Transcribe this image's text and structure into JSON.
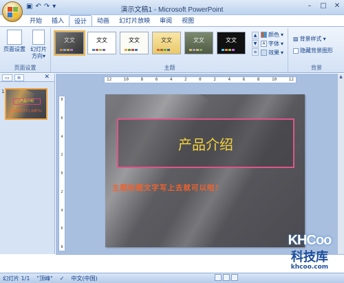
{
  "window": {
    "title": "演示文稿1 - Microsoft PowerPoint",
    "qat": {
      "save_icon": "save-icon",
      "undo_icon": "undo-icon",
      "redo_icon": "redo-icon"
    },
    "controls": {
      "minimize": "–",
      "maximize": "□",
      "close": "✕"
    }
  },
  "tabs": [
    {
      "label": "开始"
    },
    {
      "label": "插入"
    },
    {
      "label": "设计"
    },
    {
      "label": "动画"
    },
    {
      "label": "幻灯片放映"
    },
    {
      "label": "审阅"
    },
    {
      "label": "视图"
    }
  ],
  "active_tab": "设计",
  "ribbon": {
    "page_setup_group": {
      "label": "页面设置",
      "page_setup": "页面设置",
      "orientation_line1": "幻灯片",
      "orientation_line2": "方向"
    },
    "themes_group": {
      "label": "主题",
      "theme_text": "文文",
      "colors": "颜色",
      "fonts": "字体",
      "effects": "效果"
    },
    "background_group": {
      "label": "背景",
      "bg_styles": "背景样式",
      "hide_bg": "隐藏背景图形"
    }
  },
  "slide_panel": {
    "slide_number": "1",
    "thumb_title": "产品介绍",
    "thumb_sub": "主题标题文字写上去就可以啦！"
  },
  "ruler": {
    "h_ticks": [
      "12",
      "10",
      "8",
      "6",
      "4",
      "2",
      "0",
      "2",
      "4",
      "6",
      "8",
      "10",
      "12"
    ],
    "v_ticks": [
      "8",
      "6",
      "4",
      "2",
      "0",
      "2",
      "4",
      "6",
      "8"
    ]
  },
  "slide": {
    "title": "产品介绍",
    "subtitle": "主题标题文字写上去就可以啦！",
    "title_color": "#f7d33c",
    "subtitle_color": "#f0622d",
    "border_color": "#e0558a"
  },
  "status": {
    "slide_count": "幻灯片 1/1",
    "theme_name": "\"顶峰\"",
    "language": "中文(中国)"
  },
  "watermark": {
    "logo": "KHCoo",
    "cn": "科技库",
    "url": "khcoo.com"
  }
}
